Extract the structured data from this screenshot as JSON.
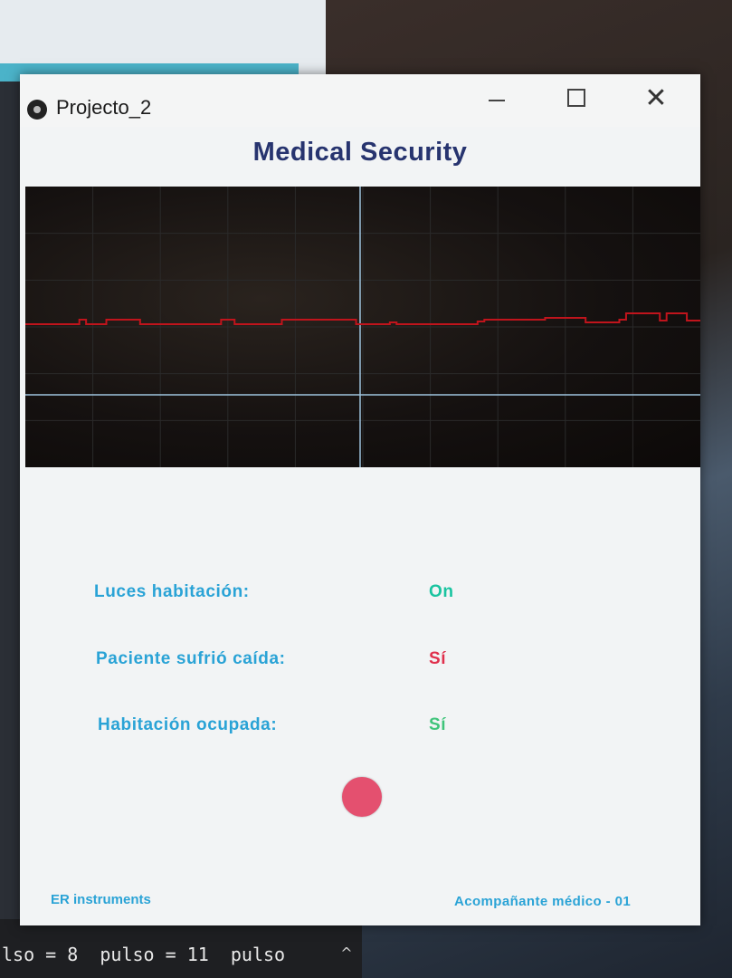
{
  "window": {
    "title": "Projecto_2",
    "controls": {
      "minimize": "—",
      "maximize": "☐",
      "close": "✕"
    }
  },
  "app": {
    "heading": "Medical Security",
    "footer_left": "ER instruments",
    "footer_right": "Acompañante médico - 01"
  },
  "status": [
    {
      "label": "Luces habitación:",
      "value": "On",
      "value_color": "#19c4a0"
    },
    {
      "label": "Paciente sufrió caída:",
      "value": "Sí",
      "value_color": "#e0304c"
    },
    {
      "label": "Habitación ocupada:",
      "value": "Sí",
      "value_color": "#3fc47a"
    }
  ],
  "indicator": {
    "color": "#e4506f"
  },
  "console": {
    "line": "lso = 8  pulso = 11  pulso"
  },
  "chart_data": {
    "type": "line",
    "title": "",
    "xlabel": "",
    "ylabel": "",
    "grid": true,
    "series": [
      {
        "color": "#c0141c",
        "x": [
          0,
          5,
          8,
          9,
          12,
          16,
          17,
          21,
          29,
          31,
          37,
          38,
          48,
          49,
          54,
          55,
          60,
          67,
          68,
          76,
          77,
          82,
          83,
          87,
          88,
          89,
          93,
          94,
          95,
          96,
          98,
          99,
          100
        ],
        "y": [
          0,
          0,
          0.5,
          0,
          0.5,
          0.5,
          0,
          0,
          0.5,
          0,
          0,
          0.5,
          0.5,
          0,
          0.2,
          0,
          0,
          0.3,
          0.5,
          0.5,
          0.7,
          0.7,
          0.2,
          0.2,
          0.5,
          1.2,
          1.2,
          0.4,
          1.2,
          1.2,
          0.4,
          0.4,
          0.4
        ]
      }
    ]
  }
}
